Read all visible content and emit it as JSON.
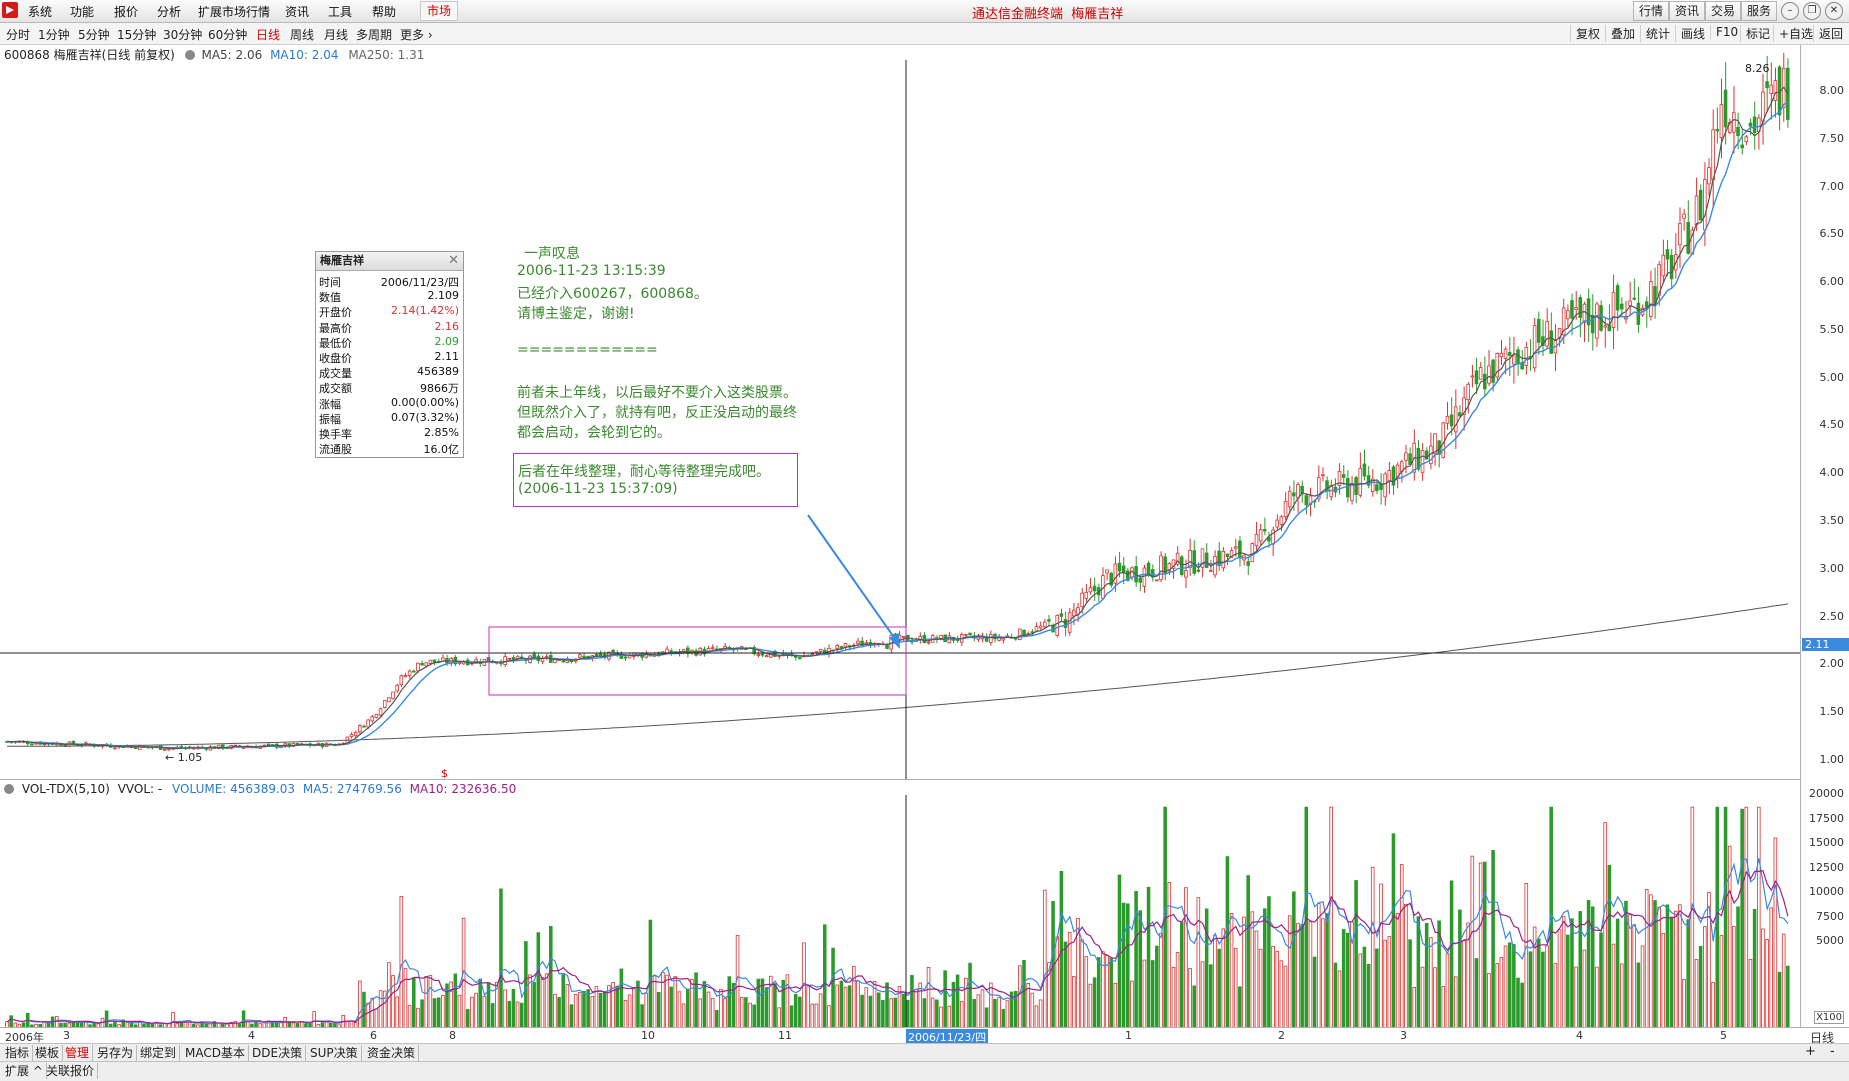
{
  "menu": {
    "items": [
      "系统",
      "功能",
      "报价",
      "分析",
      "扩展市场行情",
      "资讯",
      "工具",
      "帮助"
    ],
    "market_tab": "市场",
    "app_title": "通达信金融终端",
    "stock_title": "梅雁吉祥",
    "right_buttons": [
      "行情",
      "资讯",
      "交易",
      "服务"
    ]
  },
  "periods": [
    "分时",
    "1分钟",
    "5分钟",
    "15分钟",
    "30分钟",
    "60分钟",
    "日线",
    "周线",
    "月线",
    "多周期",
    "更多"
  ],
  "selected_period": "日线",
  "tools": [
    "复权",
    "叠加",
    "统计",
    "画线",
    "F10",
    "标记",
    "+自选",
    "返回"
  ],
  "chart_info": {
    "code_name": "600868 梅雁吉祥(日线 前复权)",
    "ma5": "MA5: 2.06",
    "ma10": "MA10: 2.04",
    "ma250": "MA250: 1.31"
  },
  "vol_info": {
    "name": "VOL-TDX(5,10)",
    "vvol": "VVOL: -",
    "volume": "VOLUME: 456389.03",
    "ma5": "MA5: 274769.56",
    "ma10": "MA10: 232636.50"
  },
  "price_axis": [
    "8.00",
    "7.50",
    "7.00",
    "6.50",
    "6.00",
    "5.50",
    "5.00",
    "4.50",
    "4.00",
    "3.50",
    "3.00",
    "2.50",
    "2.00",
    "1.50",
    "1.00"
  ],
  "current_price_tag": "2.11",
  "high_label": "8.26",
  "low_label": "1.05",
  "vol_axis": [
    "20000",
    "17500",
    "15000",
    "12500",
    "10000",
    "7500",
    "5000"
  ],
  "vol_unit": "X100",
  "tooltip": {
    "title": "梅雁吉祥",
    "rows": [
      {
        "k": "时间",
        "v": "2006/11/23/四"
      },
      {
        "k": "数值",
        "v": "2.109"
      },
      {
        "k": "开盘价",
        "v": "2.14(1.42%)"
      },
      {
        "k": "最高价",
        "v": "2.16"
      },
      {
        "k": "最低价",
        "v": "2.09"
      },
      {
        "k": "收盘价",
        "v": "2.11"
      },
      {
        "k": "成交量",
        "v": "456389"
      },
      {
        "k": "成交额",
        "v": "9866万"
      },
      {
        "k": "涨幅",
        "v": "0.00(0.00%)"
      },
      {
        "k": "振幅",
        "v": "0.07(3.32%)"
      },
      {
        "k": "换手率",
        "v": "2.85%"
      },
      {
        "k": "流通股",
        "v": "16.0亿"
      }
    ]
  },
  "notes": {
    "line1": "一声叹息",
    "line2": "2006-11-23 13:15:39",
    "line3": "已经介入600267，600868。",
    "line4": "请博主鉴定，谢谢!",
    "line5": "============",
    "line6": "前者未上年线，以后最好不要介入这类股票。",
    "line7": "但既然介入了，就持有吧，反正没启动的最终",
    "line8": "都会启动，会轮到它的。",
    "reply1": "后者在年线整理，耐心等待整理完成吧。",
    "reply2": "(2006-11-23 15:37:09)"
  },
  "x_axis": {
    "year": "2006年",
    "months": [
      "3",
      "4",
      "6",
      "8",
      "10",
      "11",
      "1",
      "2",
      "3",
      "4",
      "5"
    ],
    "cursor_date": "2006/11/23/四",
    "right_label": "日线"
  },
  "bottom_tabs": [
    "指标",
    "模板",
    "管理",
    "另存为",
    "绑定到",
    "MACD基本",
    "DDE决策",
    "SUP决策",
    "资金决策"
  ],
  "bottom_selected": "管理",
  "bottom_tabs2": [
    "扩展",
    "关联报价"
  ],
  "colors": {
    "up": "#e03030",
    "down": "#2a9a2a",
    "ma5": "#555555",
    "ma10": "#3a8adf",
    "ma250": "#555555",
    "note": "#3a8a2e",
    "box": "#c030c0"
  },
  "chart_data": {
    "type": "candlestick",
    "ylim": [
      1.0,
      8.26
    ],
    "anchors": [
      [
        0,
        1.15
      ],
      [
        40,
        1.08
      ],
      [
        80,
        1.12
      ],
      [
        88,
        1.4
      ],
      [
        95,
        1.8
      ],
      [
        100,
        1.97
      ],
      [
        130,
        2.0
      ],
      [
        175,
        2.1
      ],
      [
        190,
        2.02
      ],
      [
        210,
        2.2
      ],
      [
        240,
        2.22
      ],
      [
        255,
        2.4
      ],
      [
        265,
        2.85
      ],
      [
        285,
        3.0
      ],
      [
        300,
        3.1
      ],
      [
        310,
        3.7
      ],
      [
        330,
        3.85
      ],
      [
        345,
        4.2
      ],
      [
        355,
        4.9
      ],
      [
        365,
        5.2
      ],
      [
        380,
        5.5
      ],
      [
        392,
        5.65
      ],
      [
        400,
        6.0
      ],
      [
        408,
        6.7
      ],
      [
        413,
        7.8
      ],
      [
        420,
        7.5
      ],
      [
        428,
        7.9
      ]
    ],
    "ma250_start": 1.1,
    "ma250_end": 2.57,
    "cursor_index": 212
  }
}
